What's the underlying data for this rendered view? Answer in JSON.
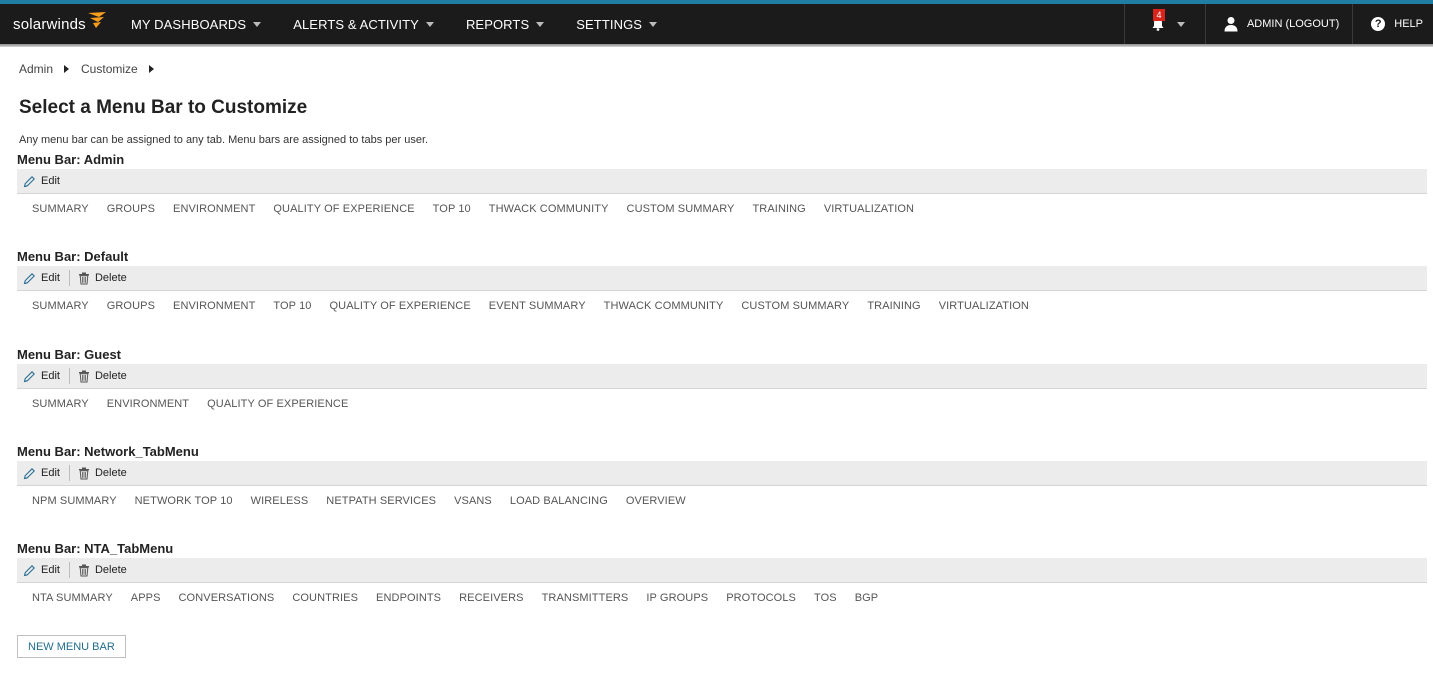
{
  "app": {
    "logo_text": "solarwinds"
  },
  "nav": [
    {
      "label": "MY DASHBOARDS"
    },
    {
      "label": "ALERTS & ACTIVITY"
    },
    {
      "label": "REPORTS"
    },
    {
      "label": "SETTINGS"
    }
  ],
  "header": {
    "notification_count": "4",
    "user_label": "ADMIN",
    "logout_label": "(LOGOUT)",
    "help_label": "HELP"
  },
  "breadcrumb": [
    {
      "label": "Admin"
    },
    {
      "label": "Customize"
    }
  ],
  "page": {
    "title": "Select a Menu Bar to Customize",
    "description": "Any menu bar can be assigned to any tab. Menu bars are assigned to tabs per user."
  },
  "toolbar": {
    "edit_label": "Edit",
    "delete_label": "Delete"
  },
  "menu_bars": [
    {
      "title": "Menu Bar: Admin",
      "deletable": false,
      "tabs": [
        "SUMMARY",
        "GROUPS",
        "ENVIRONMENT",
        "QUALITY OF EXPERIENCE",
        "TOP 10",
        "THWACK COMMUNITY",
        "CUSTOM SUMMARY",
        "TRAINING",
        "VIRTUALIZATION"
      ]
    },
    {
      "title": "Menu Bar: Default",
      "deletable": true,
      "tabs": [
        "SUMMARY",
        "GROUPS",
        "ENVIRONMENT",
        "TOP 10",
        "QUALITY OF EXPERIENCE",
        "EVENT SUMMARY",
        "THWACK COMMUNITY",
        "CUSTOM SUMMARY",
        "TRAINING",
        "VIRTUALIZATION"
      ]
    },
    {
      "title": "Menu Bar: Guest",
      "deletable": true,
      "tabs": [
        "SUMMARY",
        "ENVIRONMENT",
        "QUALITY OF EXPERIENCE"
      ]
    },
    {
      "title": "Menu Bar: Network_TabMenu",
      "deletable": true,
      "tabs": [
        "NPM SUMMARY",
        "NETWORK TOP 10",
        "WIRELESS",
        "NETPATH SERVICES",
        "VSANS",
        "LOAD BALANCING",
        "OVERVIEW"
      ]
    },
    {
      "title": "Menu Bar: NTA_TabMenu",
      "deletable": true,
      "tabs": [
        "NTA SUMMARY",
        "APPS",
        "CONVERSATIONS",
        "COUNTRIES",
        "ENDPOINTS",
        "RECEIVERS",
        "TRANSMITTERS",
        "IP GROUPS",
        "PROTOCOLS",
        "TOS",
        "BGP"
      ]
    }
  ],
  "new_button_label": "NEW MENU BAR",
  "colors": {
    "accent_bar": "#1f7ea1",
    "topbar_bg": "#1b1b1b",
    "logo_flame": "#f99d1c",
    "badge": "#d9241c",
    "link": "#1f6d8c"
  }
}
